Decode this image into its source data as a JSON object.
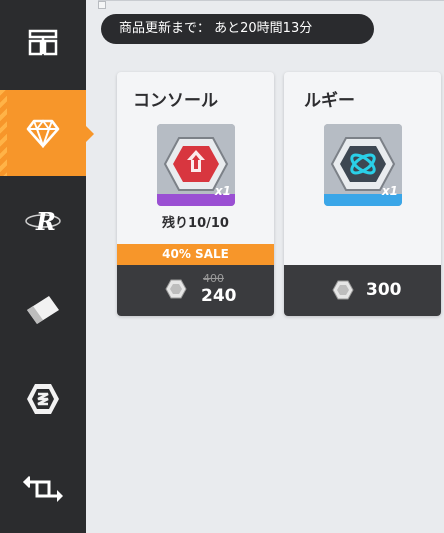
{
  "timer": {
    "text": "商品更新まで： あと20時間13分"
  },
  "sidebar": {
    "items": [
      {
        "icon": "shop-icon",
        "active": false
      },
      {
        "icon": "diamond-icon",
        "active": true
      },
      {
        "icon": "r-emblem-icon",
        "active": false
      },
      {
        "icon": "ticket-icon",
        "active": false
      },
      {
        "icon": "hex-coin-icon",
        "active": false
      },
      {
        "icon": "exchange-arrows-icon",
        "active": false
      }
    ]
  },
  "cards": [
    {
      "title": "コンソール",
      "quantity": "x1",
      "stock": "残り10/10",
      "sale": "40% SALE",
      "price_old": "400",
      "price": "240",
      "rarity_color": "#9a4fd3",
      "emblem_color": "#d8363f"
    },
    {
      "title": "ルギー",
      "quantity": "x1",
      "price": "300",
      "rarity_color": "#3aa6e8",
      "emblem_color": "#2aa7c9"
    }
  ],
  "colors": {
    "accent": "#f7962a",
    "sidebar": "#2b2c2e",
    "price_bar": "#3a3b3e",
    "background": "#e9ebee"
  }
}
